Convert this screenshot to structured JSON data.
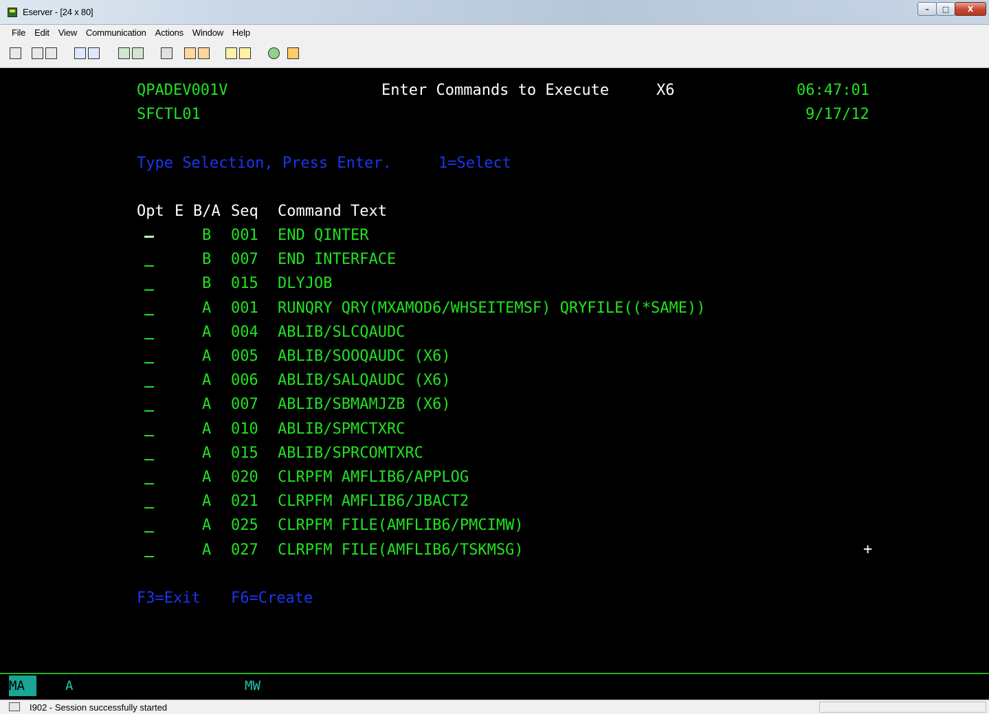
{
  "window": {
    "title": "Eserver - [24 x 80]",
    "minimize_glyph": "–",
    "maximize_glyph": "□",
    "close_glyph": "X"
  },
  "menu": [
    "File",
    "Edit",
    "View",
    "Communication",
    "Actions",
    "Window",
    "Help"
  ],
  "toolbar": {
    "icons": [
      "print-screen-icon",
      "copy-icon",
      "paste-icon",
      "send-icon",
      "receive-icon",
      "display-icon",
      "keyboard-icon",
      "macro-icon",
      "record-icon",
      "stop-icon",
      "play-macro-icon",
      "edit-macro-icon",
      "globe-icon",
      "pencil-icon"
    ]
  },
  "screen": {
    "device": "QPADEV001V",
    "program": "SFCTL01",
    "title": "Enter Commands to Execute",
    "code": "X6",
    "time": "06:47:01",
    "date": "9/17/12",
    "instruction": "Type Selection, Press Enter.",
    "option_hint": "1=Select",
    "headers": {
      "opt": "Opt",
      "e": "E",
      "ba": "B/A",
      "seq": "Seq",
      "command": "Command Text"
    },
    "rows": [
      {
        "ba": "B",
        "seq": "001",
        "command": "END QINTER"
      },
      {
        "ba": "B",
        "seq": "007",
        "command": "END INTERFACE"
      },
      {
        "ba": "B",
        "seq": "015",
        "command": "DLYJOB"
      },
      {
        "ba": "A",
        "seq": "001",
        "command": "RUNQRY QRY(MXAMOD6/WHSEITEMSF) QRYFILE((*SAME))"
      },
      {
        "ba": "A",
        "seq": "004",
        "command": "ABLIB/SLCQAUDC"
      },
      {
        "ba": "A",
        "seq": "005",
        "command": "ABLIB/SOOQAUDC (X6)"
      },
      {
        "ba": "A",
        "seq": "006",
        "command": "ABLIB/SALQAUDC (X6)"
      },
      {
        "ba": "A",
        "seq": "007",
        "command": "ABLIB/SBMAMJZB (X6)"
      },
      {
        "ba": "A",
        "seq": "010",
        "command": "ABLIB/SPMCTXRC"
      },
      {
        "ba": "A",
        "seq": "015",
        "command": "ABLIB/SPRCOMTXRC"
      },
      {
        "ba": "A",
        "seq": "020",
        "command": "CLRPFM AMFLIB6/APPLOG"
      },
      {
        "ba": "A",
        "seq": "021",
        "command": "CLRPFM AMFLIB6/JBACT2"
      },
      {
        "ba": "A",
        "seq": "025",
        "command": "CLRPFM FILE(AMFLIB6/PMCIMW)"
      },
      {
        "ba": "A",
        "seq": "027",
        "command": "CLRPFM FILE(AMFLIB6/TSKMSG)"
      }
    ],
    "more_indicator": "+",
    "fkey_exit": "F3=Exit",
    "fkey_create": "F6=Create"
  },
  "oia": {
    "mode": "MA",
    "field1": "A",
    "field2": "MW"
  },
  "status": {
    "message": "I902 - Session successfully started"
  },
  "colors": {
    "screen_bg": "#000000",
    "field_green": "#21e221",
    "prompt_blue": "#1a36f0",
    "oia_teal": "#1fc7b0"
  }
}
